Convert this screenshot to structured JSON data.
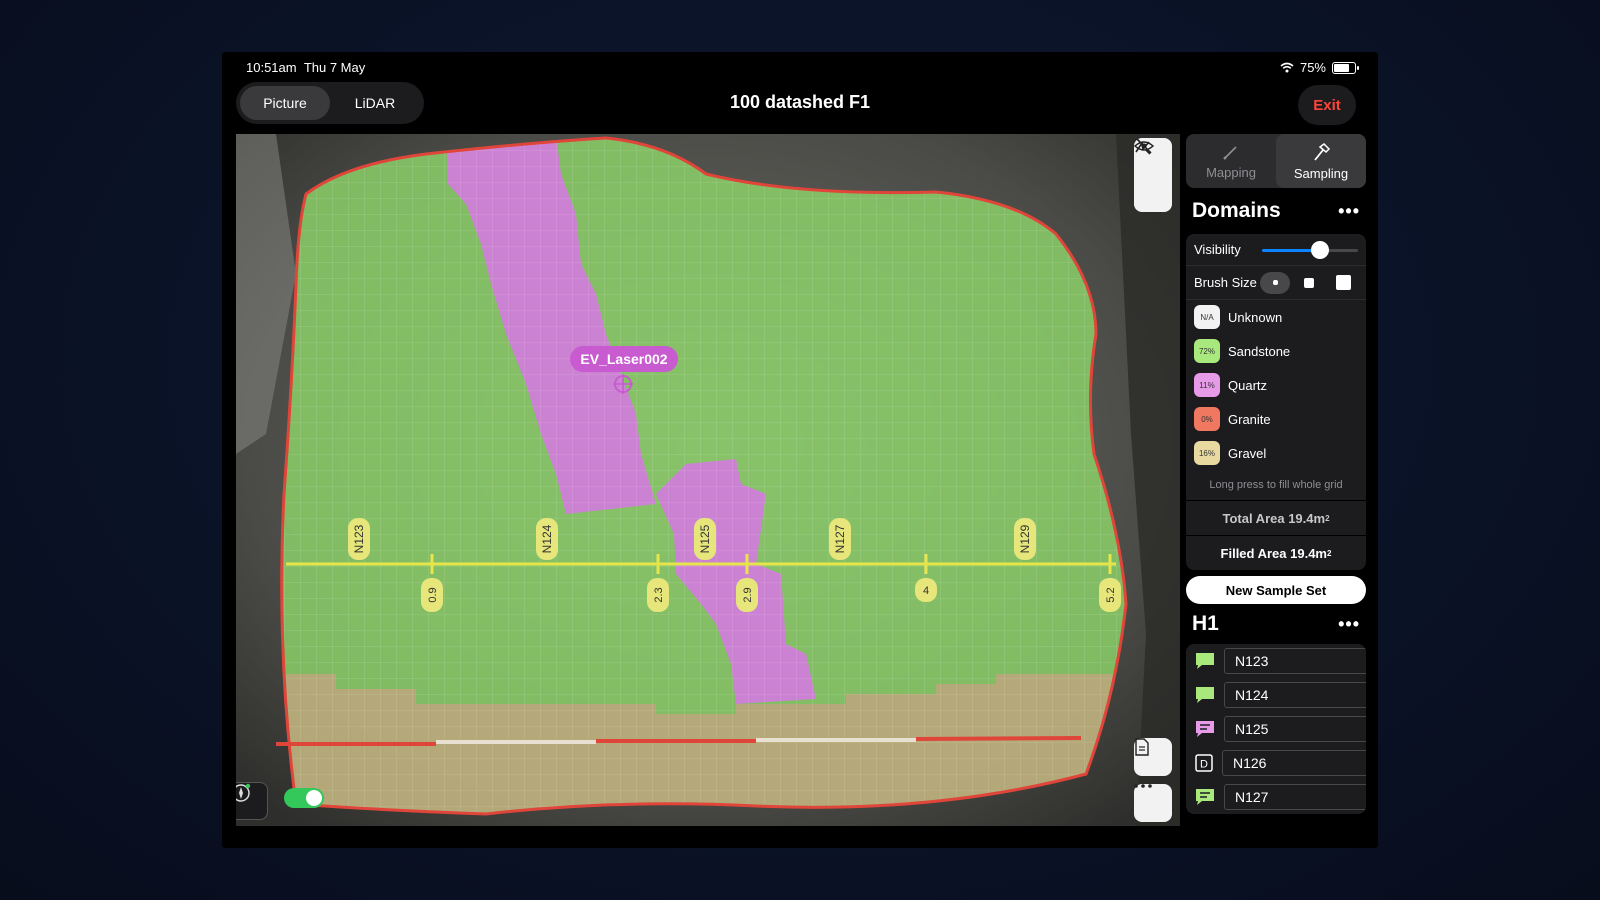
{
  "status": {
    "time": "10:51am",
    "date": "Thu 7 May",
    "battery": "75%",
    "battery_level": 0.75
  },
  "header": {
    "tabs": [
      {
        "label": "Picture",
        "active": true
      },
      {
        "label": "LiDAR",
        "active": false
      }
    ],
    "title": "100 datashed F1",
    "exit_label": "Exit"
  },
  "map": {
    "marker_label": "EV_Laser002",
    "sample_labels": [
      "N123",
      "N124",
      "N125",
      "N127",
      "N129"
    ],
    "distance_labels": [
      "0.9",
      "2.3",
      "2.9",
      "4",
      "5.2"
    ],
    "layers_toggle_on": true
  },
  "sidebar": {
    "modes": [
      {
        "label": "Mapping",
        "icon": "pencil-icon",
        "active": false
      },
      {
        "label": "Sampling",
        "icon": "hammer-icon",
        "active": true
      }
    ],
    "domains_title": "Domains",
    "visibility_label": "Visibility",
    "visibility_value": 0.6,
    "brush_label": "Brush Size",
    "brush_selected": 0,
    "domains": [
      {
        "chip": "N/A",
        "name": "Unknown",
        "color": "#f2f2f2"
      },
      {
        "chip": "72%",
        "name": "Sandstone",
        "color": "#a8e87c"
      },
      {
        "chip": "11%",
        "name": "Quartz",
        "color": "#e79ae8"
      },
      {
        "chip": "0%",
        "name": "Granite",
        "color": "#f07860"
      },
      {
        "chip": "16%",
        "name": "Gravel",
        "color": "#e8d9a0"
      }
    ],
    "hint": "Long press to fill whole grid",
    "total_area": "Total Area 19.4m",
    "filled_area": "Filled Area 19.4m",
    "area_unit_sup": "2",
    "new_sample_label": "New Sample Set",
    "set_title": "H1",
    "samples": [
      {
        "name": "N123",
        "icon": "speech-bubble-icon",
        "color": "#a8e87c"
      },
      {
        "name": "N124",
        "icon": "speech-bubble-icon",
        "color": "#a8e87c"
      },
      {
        "name": "N125",
        "icon": "speech-bubble-lines-icon",
        "color": "#e79ae8"
      },
      {
        "name": "N126",
        "icon": "d-box-icon",
        "color": "#ffffff"
      },
      {
        "name": "N127",
        "icon": "speech-bubble-lines-icon",
        "color": "#a8e87c"
      }
    ]
  }
}
